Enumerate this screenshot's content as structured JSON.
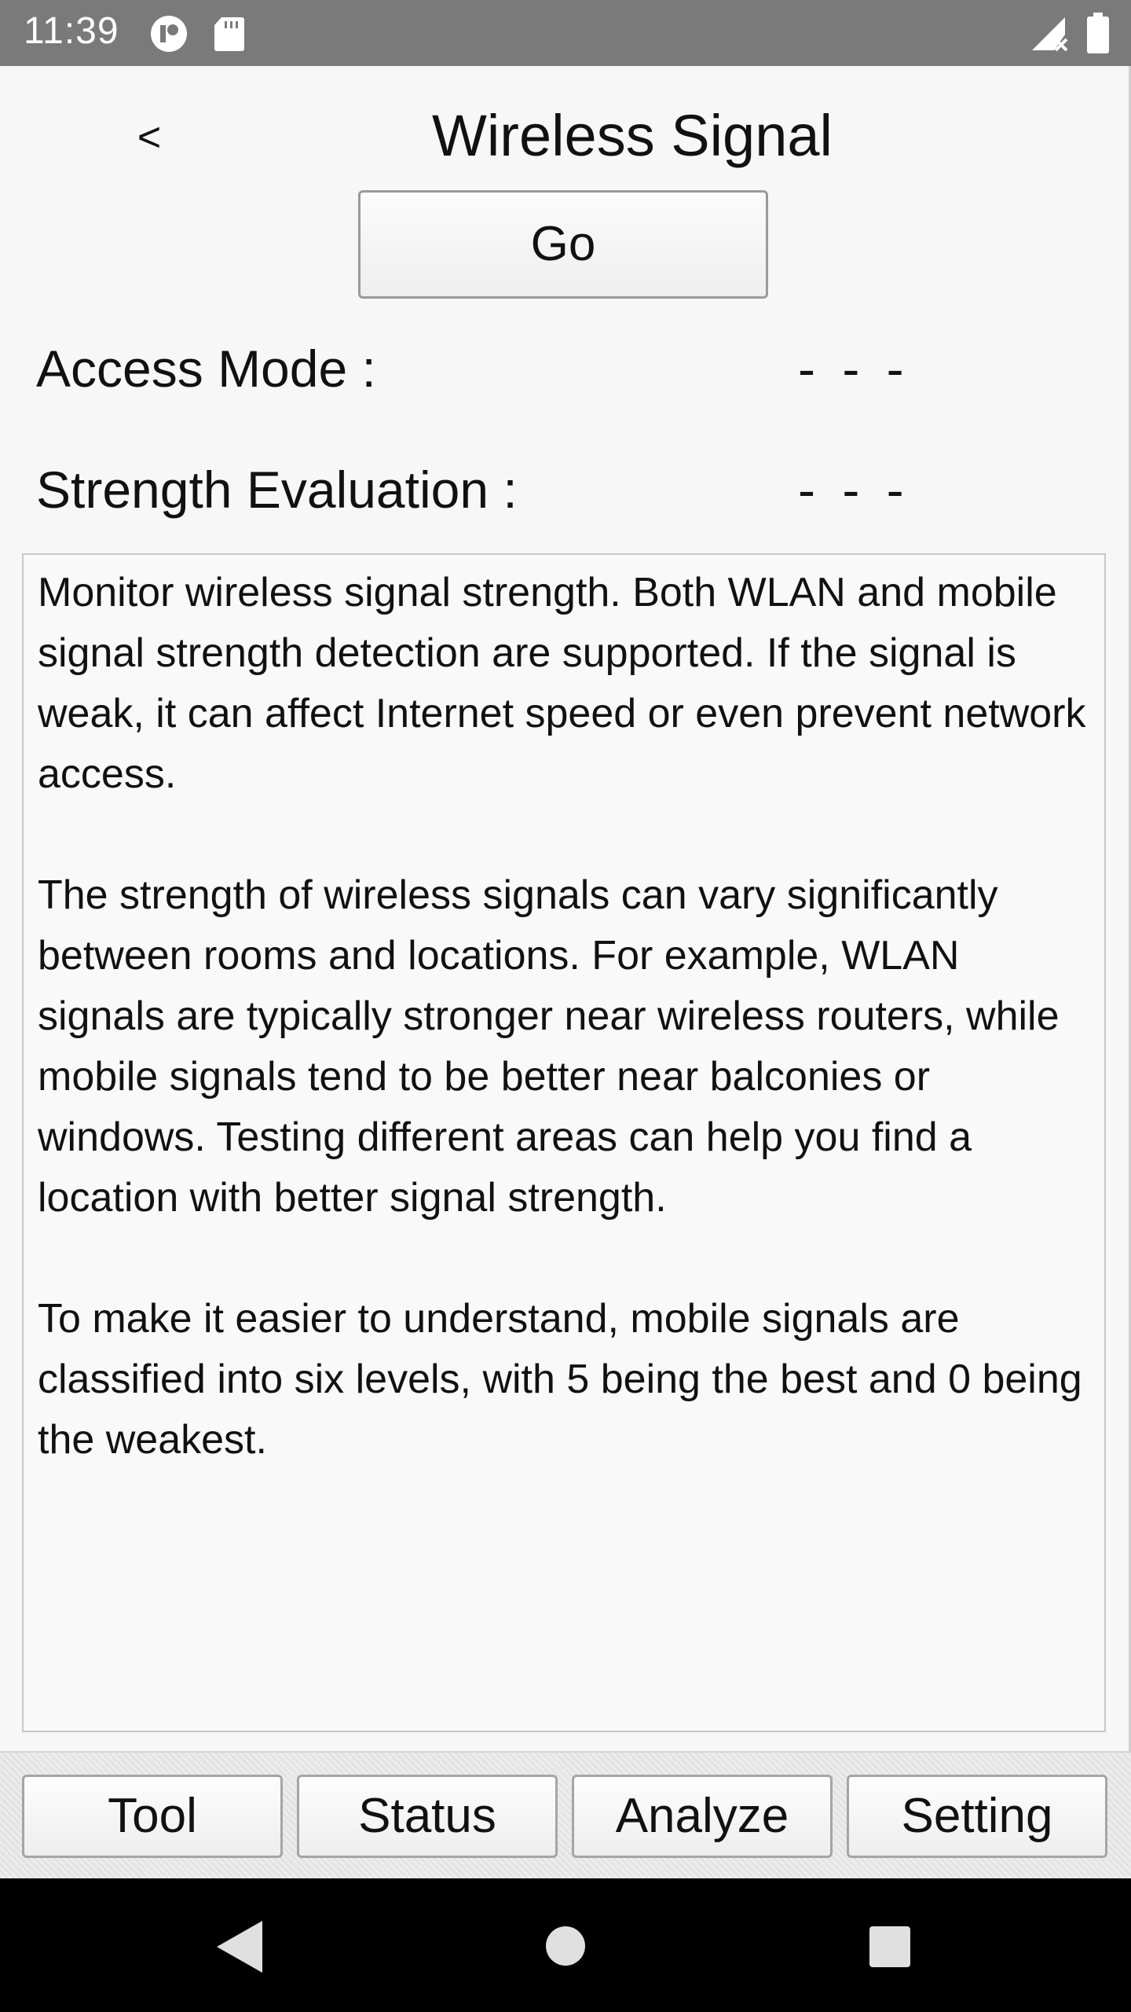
{
  "status_bar": {
    "time": "11:39",
    "icons": [
      "app-notification-icon",
      "sd-card-icon",
      "signal-no-data-icon",
      "battery-icon"
    ]
  },
  "header": {
    "back_label": "<",
    "title": "Wireless Signal"
  },
  "go_button": {
    "label": "Go"
  },
  "info_rows": {
    "access_mode": {
      "label": "Access Mode :",
      "value": "- - -"
    },
    "strength_evaluation": {
      "label": "Strength Evaluation :",
      "value": "- - -"
    }
  },
  "description": {
    "paragraphs": [
      "Monitor wireless signal strength. Both WLAN and mobile signal strength detection are supported. If the signal is weak, it can affect Internet speed or even prevent network access.",
      "The strength of wireless signals can vary significantly between rooms and locations. For example, WLAN signals are typically stronger near wireless routers, while mobile signals tend to be better near balconies or windows. Testing different areas can help you find a location with better signal strength.",
      "To make it easier to understand, mobile signals are classified into six levels, with 5 being the best and 0 being the weakest."
    ]
  },
  "tabs": [
    {
      "label": "Tool"
    },
    {
      "label": "Status"
    },
    {
      "label": "Analyze"
    },
    {
      "label": "Setting"
    }
  ],
  "nav_bar": {
    "icons": [
      "nav-back-icon",
      "nav-home-icon",
      "nav-recents-icon"
    ]
  },
  "colors": {
    "status_bar_bg": "#7a7a7a",
    "page_bg": "#f7f7f7",
    "nav_bar_bg": "#000000",
    "button_border": "#9a9a9a"
  }
}
